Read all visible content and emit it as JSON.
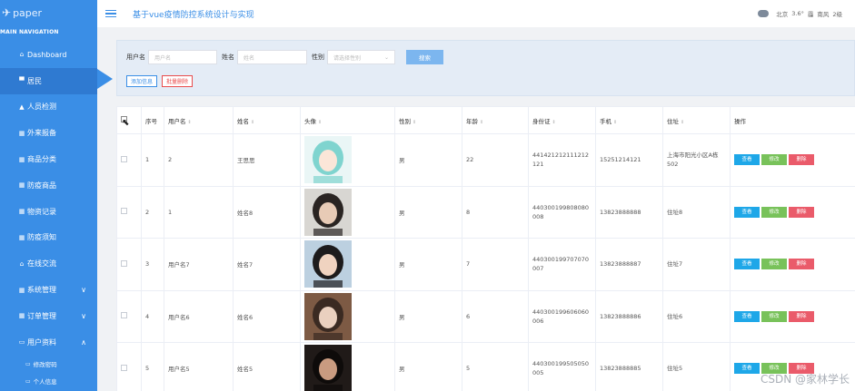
{
  "brand": "paper",
  "nav_header": "MAIN NAVIGATION",
  "sidebar": {
    "items": [
      {
        "label": "Dashboard",
        "icon": "home-icon"
      },
      {
        "label": "居民",
        "icon": "comment-icon"
      },
      {
        "label": "人员检测",
        "icon": "user-icon"
      },
      {
        "label": "外来报备",
        "icon": "grid-icon"
      },
      {
        "label": "商品分类",
        "icon": "grid-icon"
      },
      {
        "label": "防疫商品",
        "icon": "grid-icon"
      },
      {
        "label": "物资记录",
        "icon": "grid-icon"
      },
      {
        "label": "防疫须知",
        "icon": "grid-icon"
      },
      {
        "label": "在线交流",
        "icon": "home-icon"
      },
      {
        "label": "系统管理",
        "icon": "grid-icon",
        "chevron": "∨"
      },
      {
        "label": "订单管理",
        "icon": "grid-icon",
        "chevron": "∨"
      },
      {
        "label": "用户资料",
        "icon": "folder-icon",
        "chevron": "∧"
      }
    ],
    "sub_items": [
      {
        "label": "修改密码",
        "icon": "folder-icon"
      },
      {
        "label": "个人信息",
        "icon": "folder-icon"
      }
    ]
  },
  "header": {
    "title": "基于vue疫情防控系统设计与实现",
    "weather": {
      "city": "北京",
      "temp": "3.6°",
      "condition": "霾",
      "wind": "南风",
      "level": "2级"
    }
  },
  "search": {
    "username_label": "用户名",
    "username_placeholder": "用户名",
    "name_label": "姓名",
    "name_placeholder": "姓名",
    "sex_label": "性别",
    "sex_placeholder": "请选择性别",
    "search_button": "搜索",
    "add_button": "添加信息",
    "batch_delete_button": "批量删除"
  },
  "table": {
    "columns": [
      "序号",
      "用户名",
      "姓名",
      "头像",
      "性别",
      "年龄",
      "身份证",
      "手机",
      "住址",
      "操作"
    ],
    "rows": [
      {
        "index": "1",
        "username": "2",
        "name": "王思思",
        "sex": "男",
        "age": "22",
        "id_card": "441421212111212121",
        "phone": "15251214121",
        "address": "上海市阳光小区A栋502"
      },
      {
        "index": "2",
        "username": "1",
        "name": "姓名8",
        "sex": "男",
        "age": "8",
        "id_card": "440300199808080008",
        "phone": "13823888888",
        "address": "住址8"
      },
      {
        "index": "3",
        "username": "用户名7",
        "name": "姓名7",
        "sex": "男",
        "age": "7",
        "id_card": "440300199707070007",
        "phone": "13823888887",
        "address": "住址7"
      },
      {
        "index": "4",
        "username": "用户名6",
        "name": "姓名6",
        "sex": "男",
        "age": "6",
        "id_card": "440300199606060006",
        "phone": "13823888886",
        "address": "住址6"
      },
      {
        "index": "5",
        "username": "用户名5",
        "name": "姓名5",
        "sex": "男",
        "age": "5",
        "id_card": "440300199505050005",
        "phone": "13823888885",
        "address": "住址5"
      }
    ],
    "actions": {
      "view": "查看",
      "edit": "修改",
      "delete": "删除"
    }
  },
  "watermark": "CSDN @家林学长",
  "colors": {
    "sidebar": "#3a8ee6",
    "accent": "#3a8ee6",
    "view": "#1ea7e8",
    "edit": "#78c25a",
    "delete": "#ea5b6a"
  }
}
